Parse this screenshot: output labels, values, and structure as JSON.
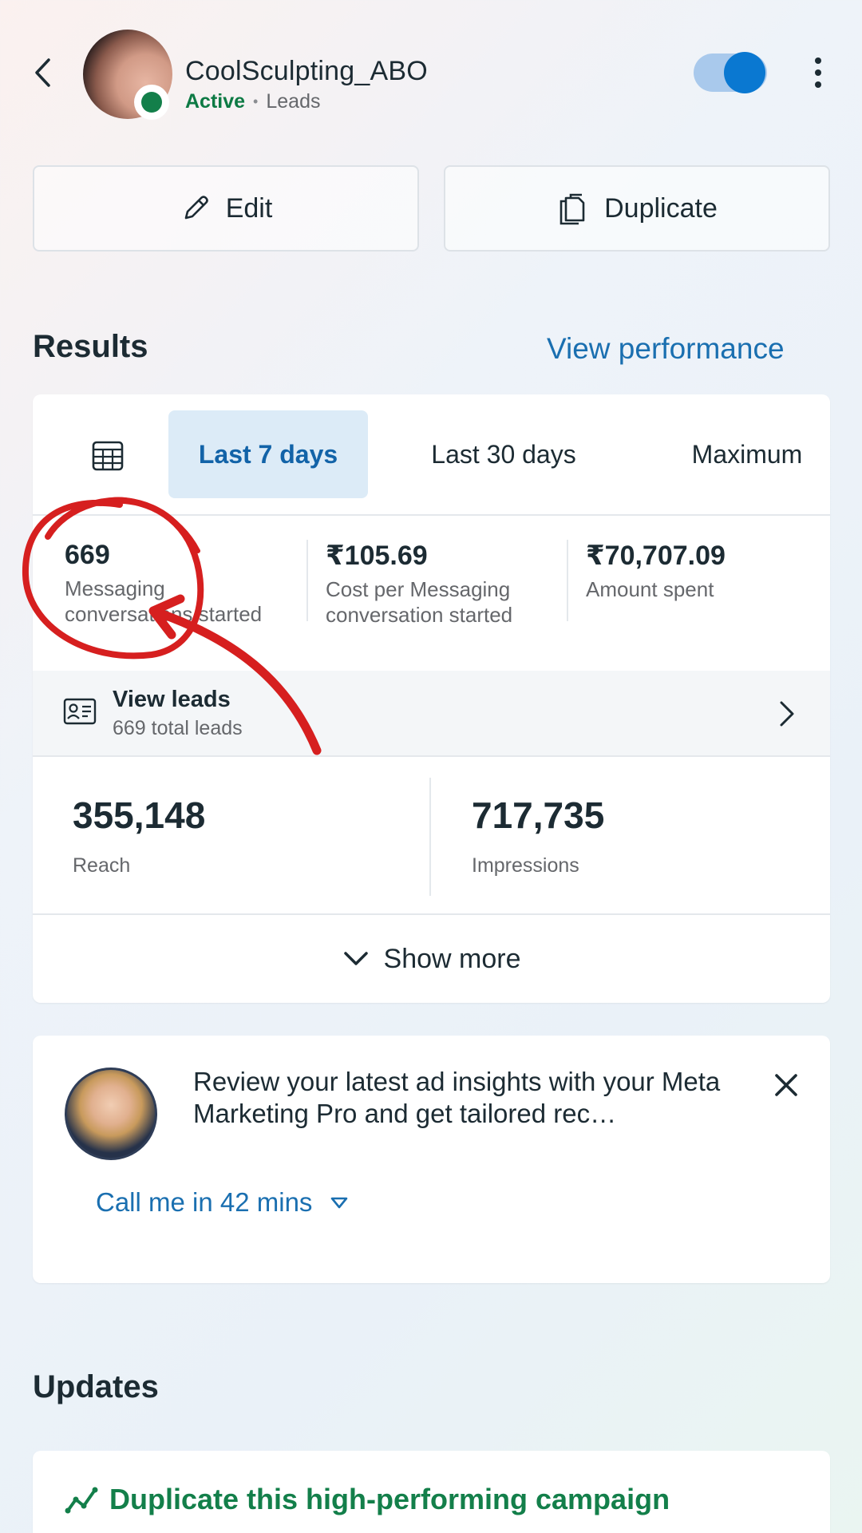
{
  "header": {
    "campaign_name": "CoolSculpting_ABO",
    "status": "Active",
    "separator": "•",
    "objective": "Leads",
    "toggle_on": true
  },
  "actions": {
    "edit_label": "Edit",
    "duplicate_label": "Duplicate"
  },
  "results": {
    "title": "Results",
    "view_performance": "View performance",
    "tabs": [
      {
        "label": "Last 7 days",
        "selected": true
      },
      {
        "label": "Last 30 days",
        "selected": false
      },
      {
        "label": "Maximum",
        "selected": false
      }
    ],
    "metrics": [
      {
        "value": "669",
        "label": "Messaging conversations started"
      },
      {
        "value": "₹105.69",
        "label": "Cost per Messaging conversation started"
      },
      {
        "value": "₹70,707.09",
        "label": "Amount spent"
      }
    ],
    "leads": {
      "title": "View leads",
      "subtitle": "669 total leads"
    },
    "reach": {
      "value": "355,148",
      "label": "Reach"
    },
    "impressions": {
      "value": "717,735",
      "label": "Impressions"
    },
    "show_more": "Show more"
  },
  "insights": {
    "message": "Review your latest ad insights with your Meta Marketing Pro and get tailored rec…",
    "call_me": "Call me in 42 mins"
  },
  "updates": {
    "title": "Updates",
    "suggestion": "Duplicate this high-performing campaign"
  },
  "colors": {
    "accent": "#1a6fb0",
    "active_green": "#0d7a44",
    "annotation_red": "#d61f1f"
  }
}
